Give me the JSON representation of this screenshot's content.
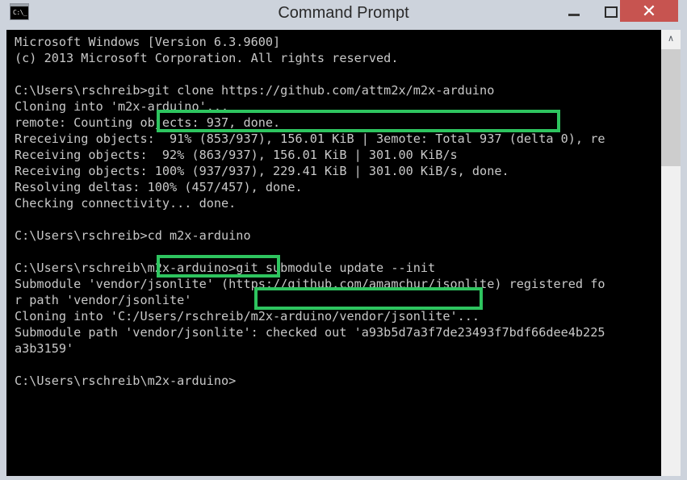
{
  "window": {
    "title": "Command Prompt",
    "icon_name": "command-prompt-icon",
    "icon_glyph": "C:\\_",
    "close_color": "#c75450",
    "titlebar_color": "#cdd3dc",
    "buttons": {
      "minimize_label": "—",
      "maximize_label": "□",
      "close_label": "✕"
    }
  },
  "console": {
    "background": "#000000",
    "foreground": "#c8c8c8",
    "lines": [
      "Microsoft Windows [Version 6.3.9600]",
      "(c) 2013 Microsoft Corporation. All rights reserved.",
      "",
      "C:\\Users\\rschreib>git clone https://github.com/attm2x/m2x-arduino",
      "Cloning into 'm2x-arduino'...",
      "remote: Counting objects: 937, done.",
      "Rreceiving objects:  91% (853/937), 156.01 KiB | 3emote: Total 937 (delta 0), re",
      "Receiving objects:  92% (863/937), 156.01 KiB | 301.00 KiB/s",
      "Receiving objects: 100% (937/937), 229.41 KiB | 301.00 KiB/s, done.",
      "Resolving deltas: 100% (457/457), done.",
      "Checking connectivity... done.",
      "",
      "C:\\Users\\rschreib>cd m2x-arduino",
      "",
      "C:\\Users\\rschreib\\m2x-arduino>git submodule update --init",
      "Submodule 'vendor/jsonlite' (https://github.com/amamchur/jsonlite) registered fo",
      "r path 'vendor/jsonlite'",
      "Cloning into 'C:/Users/rschreib/m2x-arduino/vendor/jsonlite'...",
      "Submodule path 'vendor/jsonlite': checked out 'a93b5d7a3f7de23493f7bdf66dee4b225",
      "a3b3159'",
      "",
      "C:\\Users\\rschreib\\m2x-arduino>"
    ]
  },
  "highlights": {
    "color": "#2ec45f",
    "items": [
      {
        "name": "git-clone-command",
        "text": "git clone https://github.com/attm2x/m2x-arduino"
      },
      {
        "name": "cd-command",
        "text": "cd m2x-arduino"
      },
      {
        "name": "git-submodule-command",
        "text": "git submodule update --init"
      }
    ]
  },
  "scrollbar": {
    "up_arrow_glyph": "∧",
    "thumb_color": "#cdcdcd",
    "track_color": "#f0f0f0"
  }
}
